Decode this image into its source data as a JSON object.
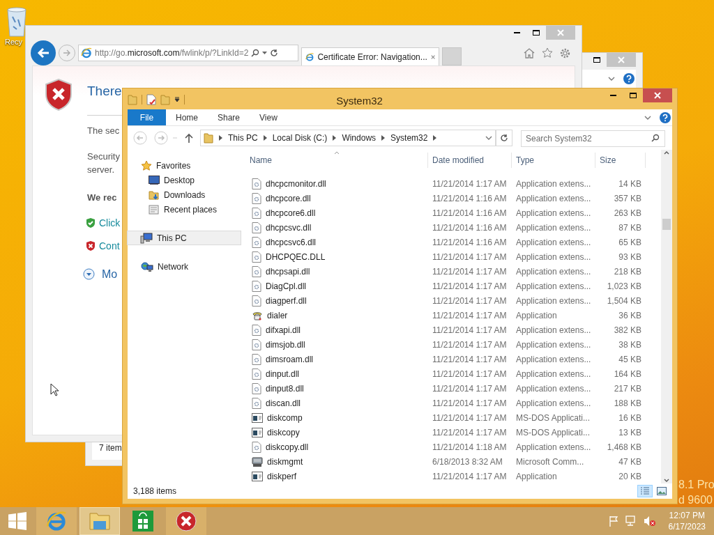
{
  "desktop": {
    "recycle_label": "Recy",
    "watermark": [
      "8.1 Pro",
      "d 9600"
    ]
  },
  "back_window": {
    "status": "7 item"
  },
  "browser": {
    "url": {
      "prefix": "http://go.",
      "domain": "microsoft.com",
      "suffix": "/fwlink/p/?LinkId=2"
    },
    "tab": {
      "title": "Certificate Error: Navigation...",
      "selected": true
    },
    "page": {
      "heading": "There",
      "line_1": "The sec",
      "line_2": "Security",
      "line_3": "server.",
      "recommend": "We rec",
      "options": [
        {
          "kind": "safe",
          "text": "Click"
        },
        {
          "kind": "danger",
          "text": "Cont"
        }
      ],
      "more": "Mo"
    }
  },
  "explorer": {
    "title": "System32",
    "ribbon": {
      "file_tab": "File",
      "tabs": [
        "Home",
        "Share",
        "View"
      ]
    },
    "breadcrumb": [
      "This PC",
      "Local Disk (C:)",
      "Windows",
      "System32"
    ],
    "search": {
      "placeholder": "Search System32"
    },
    "sidebar": [
      {
        "kind": "favorites",
        "label": "Favorites",
        "selected": false,
        "children": [
          {
            "kind": "desktop",
            "label": "Desktop",
            "selected": false
          },
          {
            "kind": "downloads",
            "label": "Downloads",
            "selected": false
          },
          {
            "kind": "recent",
            "label": "Recent places",
            "selected": false
          }
        ]
      },
      {
        "kind": "pc",
        "label": "This PC",
        "selected": true
      },
      {
        "kind": "network",
        "label": "Network",
        "selected": false
      }
    ],
    "columns": [
      "Name",
      "Date modified",
      "Type",
      "Size"
    ],
    "files": [
      {
        "kind": "dll",
        "name": "dhcpcmonitor.dll",
        "date": "11/21/2014 1:17 AM",
        "type": "Application extens...",
        "size": "14 KB"
      },
      {
        "kind": "dll",
        "name": "dhcpcore.dll",
        "date": "11/21/2014 1:16 AM",
        "type": "Application extens...",
        "size": "357 KB"
      },
      {
        "kind": "dll",
        "name": "dhcpcore6.dll",
        "date": "11/21/2014 1:16 AM",
        "type": "Application extens...",
        "size": "263 KB"
      },
      {
        "kind": "dll",
        "name": "dhcpcsvc.dll",
        "date": "11/21/2014 1:16 AM",
        "type": "Application extens...",
        "size": "87 KB"
      },
      {
        "kind": "dll",
        "name": "dhcpcsvc6.dll",
        "date": "11/21/2014 1:16 AM",
        "type": "Application extens...",
        "size": "65 KB"
      },
      {
        "kind": "dll",
        "name": "DHCPQEC.DLL",
        "date": "11/21/2014 1:17 AM",
        "type": "Application extens...",
        "size": "93 KB"
      },
      {
        "kind": "dll",
        "name": "dhcpsapi.dll",
        "date": "11/21/2014 1:17 AM",
        "type": "Application extens...",
        "size": "218 KB"
      },
      {
        "kind": "dll",
        "name": "DiagCpl.dll",
        "date": "11/21/2014 1:17 AM",
        "type": "Application extens...",
        "size": "1,023 KB"
      },
      {
        "kind": "dll",
        "name": "diagperf.dll",
        "date": "11/21/2014 1:17 AM",
        "type": "Application extens...",
        "size": "1,504 KB"
      },
      {
        "kind": "phone",
        "name": "dialer",
        "date": "11/21/2014 1:17 AM",
        "type": "Application",
        "size": "36 KB"
      },
      {
        "kind": "dll",
        "name": "difxapi.dll",
        "date": "11/21/2014 1:17 AM",
        "type": "Application extens...",
        "size": "382 KB"
      },
      {
        "kind": "dll",
        "name": "dimsjob.dll",
        "date": "11/21/2014 1:17 AM",
        "type": "Application extens...",
        "size": "38 KB"
      },
      {
        "kind": "dll",
        "name": "dimsroam.dll",
        "date": "11/21/2014 1:17 AM",
        "type": "Application extens...",
        "size": "45 KB"
      },
      {
        "kind": "dll",
        "name": "dinput.dll",
        "date": "11/21/2014 1:17 AM",
        "type": "Application extens...",
        "size": "164 KB"
      },
      {
        "kind": "dll",
        "name": "dinput8.dll",
        "date": "11/21/2014 1:17 AM",
        "type": "Application extens...",
        "size": "217 KB"
      },
      {
        "kind": "dll",
        "name": "discan.dll",
        "date": "11/21/2014 1:17 AM",
        "type": "Application extens...",
        "size": "188 KB"
      },
      {
        "kind": "console",
        "name": "diskcomp",
        "date": "11/21/2014 1:17 AM",
        "type": "MS-DOS Applicati...",
        "size": "16 KB"
      },
      {
        "kind": "console",
        "name": "diskcopy",
        "date": "11/21/2014 1:17 AM",
        "type": "MS-DOS Applicati...",
        "size": "13 KB"
      },
      {
        "kind": "dll",
        "name": "diskcopy.dll",
        "date": "11/21/2014 1:18 AM",
        "type": "Application extens...",
        "size": "1,468 KB"
      },
      {
        "kind": "console_mgmt",
        "name": "diskmgmt",
        "date": "6/18/2013 8:32 AM",
        "type": "Microsoft Comm...",
        "size": "47 KB"
      },
      {
        "kind": "console",
        "name": "diskperf",
        "date": "11/21/2014 1:17 AM",
        "type": "Application",
        "size": "20 KB"
      }
    ],
    "status": "3,188 items",
    "view_modes": [
      {
        "kind": "details",
        "selected": true
      },
      {
        "kind": "large_icons",
        "selected": false
      }
    ]
  },
  "taskbar": {
    "apps": [
      {
        "kind": "ie",
        "selected": false
      },
      {
        "kind": "explorer",
        "selected": true
      },
      {
        "kind": "store",
        "selected": false
      },
      {
        "kind": "error",
        "selected": false
      }
    ],
    "time": "12:07 PM",
    "date": "6/17/2023"
  }
}
